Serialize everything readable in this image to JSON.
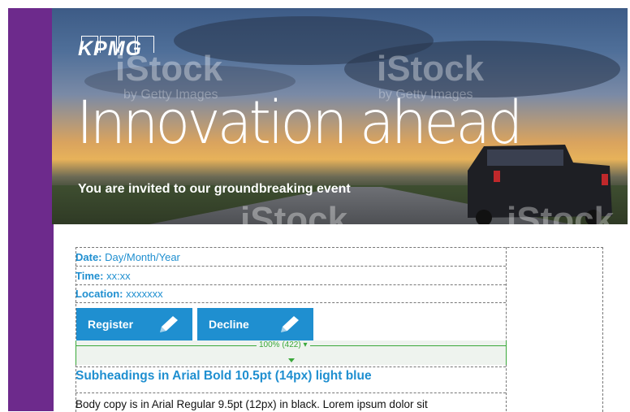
{
  "header": {
    "logo_text": "KPMG",
    "title": "Innovation ahead",
    "subtitle": "You are invited to our groundbreaking event",
    "watermarks": [
      "iStock",
      "iStock",
      "iStock",
      "iStock"
    ],
    "watermark_credits": [
      "by Getty Images",
      "by Getty Images"
    ]
  },
  "details": {
    "date_label": "Date:",
    "date_value": "Day/Month/Year",
    "time_label": "Time:",
    "time_value": "xx:xx",
    "location_label": "Location:",
    "location_value": "xxxxxxx"
  },
  "buttons": {
    "register_label": "Register",
    "decline_label": "Decline"
  },
  "zoom": {
    "label": "100% (422)",
    "arrow_glyph": "▾"
  },
  "content": {
    "subheading": "Subheadings in Arial Bold 10.5pt (14px) light blue",
    "body": "Body copy is in Arial Regular 9.5pt (12px) in black. Lorem ipsum dolor sit"
  },
  "colors": {
    "sidebar_purple": "#6d2a8c",
    "accent_blue": "#1f8fd0",
    "zoom_green": "#3aa83a"
  }
}
